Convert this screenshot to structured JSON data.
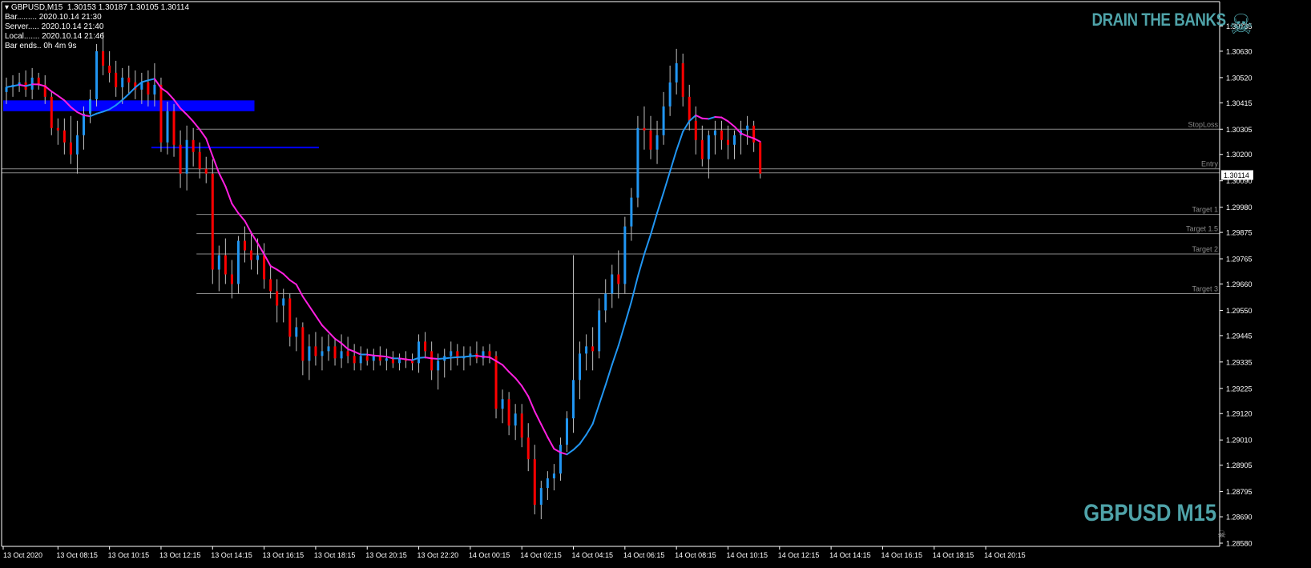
{
  "header": {
    "symbol_line": "GBPUSD,M15  1.30153 1.30187 1.30105 1.30114",
    "info_rows": [
      "Bar......... 2020.10.14 21:30",
      "Server..... 2020.10.14 21:40",
      "Local....... 2020.10.14 21:46",
      "Bar ends.. 0h 4m 9s"
    ]
  },
  "branding": {
    "title": "DRAIN THE BANKS",
    "icon": "skull-crossbones-icon",
    "symbol_title": "GBPUSD M15"
  },
  "colors": {
    "background": "#000000",
    "bull": "#2196F3",
    "bear": "#FF0000",
    "wick": "#C0C0C0",
    "ma_down": "#FF1FE0",
    "ma_up": "#2196F3",
    "zone": "#0000FF",
    "brand": "#4FA3A9",
    "level_line": "#8a8a8a"
  },
  "chart_data": {
    "type": "candlestick",
    "title": "GBPUSD,M15",
    "ylim": [
      1.2858,
      1.3079
    ],
    "y_ticks": [
      "1.30735",
      "1.30630",
      "1.30520",
      "1.30415",
      "1.30305",
      "1.30200",
      "1.30090",
      "1.29980",
      "1.29875",
      "1.29765",
      "1.29660",
      "1.29550",
      "1.29445",
      "1.29335",
      "1.29225",
      "1.29120",
      "1.29010",
      "1.28905",
      "1.28795",
      "1.28690",
      "1.28580"
    ],
    "y_tick_values": [
      1.30735,
      1.3063,
      1.3052,
      1.30415,
      1.30305,
      1.302,
      1.3009,
      1.2998,
      1.29875,
      1.29765,
      1.2966,
      1.2955,
      1.29445,
      1.29335,
      1.29225,
      1.2912,
      1.2901,
      1.28905,
      1.28795,
      1.2869,
      1.2858
    ],
    "x_ticks": [
      "13 Oct 2020",
      "13 Oct 08:15",
      "13 Oct 10:15",
      "13 Oct 12:15",
      "13 Oct 14:15",
      "13 Oct 16:15",
      "13 Oct 18:15",
      "13 Oct 20:15",
      "13 Oct 22:20",
      "14 Oct 00:15",
      "14 Oct 02:15",
      "14 Oct 04:15",
      "14 Oct 06:15",
      "14 Oct 08:15",
      "14 Oct 10:15",
      "14 Oct 12:15",
      "14 Oct 14:15",
      "14 Oct 16:15",
      "14 Oct 18:15",
      "14 Oct 20:15"
    ],
    "x_tick_index": [
      0,
      8,
      16,
      24,
      32,
      40,
      48,
      56,
      64,
      72,
      80,
      88,
      96,
      104,
      112,
      120,
      128,
      136,
      144,
      152
    ],
    "current_price": "1.30114",
    "current_price_value": 1.30114,
    "levels": [
      {
        "label": "StopLoss",
        "value": 1.30305,
        "from_index": 30
      },
      {
        "label": "Entry",
        "value": 1.3014,
        "from_index": 0
      },
      {
        "label": "Target 1",
        "value": 1.2995,
        "from_index": 30
      },
      {
        "label": "Target 1.5",
        "value": 1.2987,
        "from_index": 30
      },
      {
        "label": "Target 2",
        "value": 1.29785,
        "from_index": 30
      },
      {
        "label": "Target 3",
        "value": 1.2962,
        "from_index": 30
      }
    ],
    "zones": [
      {
        "from_index": 0,
        "to_index": 38,
        "top": 1.30425,
        "bottom": 1.3038
      },
      {
        "from_index": 23,
        "to_index": 48,
        "top": 1.30232,
        "bottom": 1.30226
      }
    ],
    "candles": [
      [
        1.3046,
        1.3052,
        1.3041,
        1.3048
      ],
      [
        1.3048,
        1.3053,
        1.3044,
        1.3049
      ],
      [
        1.3049,
        1.3054,
        1.3046,
        1.305
      ],
      [
        1.305,
        1.3055,
        1.3044,
        1.3047
      ],
      [
        1.3047,
        1.3056,
        1.3043,
        1.3052
      ],
      [
        1.3052,
        1.3054,
        1.3047,
        1.3049
      ],
      [
        1.3049,
        1.3053,
        1.3041,
        1.3044
      ],
      [
        1.3044,
        1.3046,
        1.3028,
        1.3031
      ],
      [
        1.3031,
        1.3035,
        1.3024,
        1.303
      ],
      [
        1.303,
        1.3035,
        1.302,
        1.3025
      ],
      [
        1.3025,
        1.3036,
        1.3016,
        1.302
      ],
      [
        1.302,
        1.3034,
        1.3012,
        1.3028
      ],
      [
        1.3028,
        1.304,
        1.3022,
        1.3037
      ],
      [
        1.3037,
        1.3047,
        1.3033,
        1.3043
      ],
      [
        1.3043,
        1.3066,
        1.304,
        1.3063
      ],
      [
        1.3063,
        1.3071,
        1.3053,
        1.3057
      ],
      [
        1.3057,
        1.3063,
        1.305,
        1.3054
      ],
      [
        1.3054,
        1.3059,
        1.3044,
        1.3048
      ],
      [
        1.3048,
        1.3056,
        1.3041,
        1.3052
      ],
      [
        1.3052,
        1.3057,
        1.3045,
        1.305
      ],
      [
        1.305,
        1.3055,
        1.3043,
        1.3047
      ],
      [
        1.3047,
        1.3054,
        1.3041,
        1.305
      ],
      [
        1.305,
        1.3055,
        1.304,
        1.3045
      ],
      [
        1.3045,
        1.3058,
        1.304,
        1.3049
      ],
      [
        1.3049,
        1.3052,
        1.3021,
        1.3025
      ],
      [
        1.3025,
        1.3042,
        1.302,
        1.3038
      ],
      [
        1.3038,
        1.3041,
        1.3019,
        1.3024
      ],
      [
        1.3024,
        1.303,
        1.3006,
        1.3012
      ],
      [
        1.3012,
        1.3032,
        1.3005,
        1.3026
      ],
      [
        1.3026,
        1.3031,
        1.3015,
        1.3021
      ],
      [
        1.3021,
        1.3025,
        1.301,
        1.3014
      ],
      [
        1.3014,
        1.3019,
        1.3008,
        1.3012
      ],
      [
        1.3012,
        1.3018,
        1.2966,
        1.2972
      ],
      [
        1.2972,
        1.2982,
        1.2963,
        1.2978
      ],
      [
        1.2978,
        1.2985,
        1.2966,
        1.297
      ],
      [
        1.297,
        1.2976,
        1.296,
        1.2966
      ],
      [
        1.2966,
        1.2986,
        1.2962,
        1.2984
      ],
      [
        1.2984,
        1.299,
        1.2975,
        1.298
      ],
      [
        1.298,
        1.2988,
        1.2972,
        1.2976
      ],
      [
        1.2976,
        1.2985,
        1.297,
        1.2978
      ],
      [
        1.2978,
        1.2983,
        1.2964,
        1.2968
      ],
      [
        1.2968,
        1.2974,
        1.296,
        1.2963
      ],
      [
        1.2963,
        1.2968,
        1.295,
        1.2957
      ],
      [
        1.2957,
        1.2964,
        1.295,
        1.296
      ],
      [
        1.296,
        1.2962,
        1.294,
        1.2944
      ],
      [
        1.2944,
        1.2952,
        1.2938,
        1.2948
      ],
      [
        1.2948,
        1.295,
        1.2928,
        1.2934
      ],
      [
        1.2934,
        1.2945,
        1.2926,
        1.294
      ],
      [
        1.294,
        1.2946,
        1.2932,
        1.2936
      ],
      [
        1.2936,
        1.2944,
        1.293,
        1.2938
      ],
      [
        1.2938,
        1.2945,
        1.2934,
        1.294
      ],
      [
        1.294,
        1.2943,
        1.2932,
        1.2935
      ],
      [
        1.2935,
        1.2945,
        1.2931,
        1.2938
      ],
      [
        1.2938,
        1.2944,
        1.2933,
        1.2936
      ],
      [
        1.2936,
        1.2941,
        1.293,
        1.2933
      ],
      [
        1.2933,
        1.294,
        1.293,
        1.2936
      ],
      [
        1.2936,
        1.2939,
        1.2932,
        1.2934
      ],
      [
        1.2934,
        1.2939,
        1.293,
        1.2936
      ],
      [
        1.2936,
        1.294,
        1.2932,
        1.2934
      ],
      [
        1.2934,
        1.2939,
        1.293,
        1.2935
      ],
      [
        1.2935,
        1.2938,
        1.2931,
        1.2933
      ],
      [
        1.2933,
        1.2937,
        1.293,
        1.2935
      ],
      [
        1.2935,
        1.2938,
        1.2931,
        1.2934
      ],
      [
        1.2934,
        1.2937,
        1.293,
        1.2933
      ],
      [
        1.2933,
        1.2945,
        1.2929,
        1.2942
      ],
      [
        1.2942,
        1.2946,
        1.2935,
        1.2938
      ],
      [
        1.2938,
        1.2942,
        1.2926,
        1.293
      ],
      [
        1.293,
        1.2937,
        1.2922,
        1.2934
      ],
      [
        1.2934,
        1.2939,
        1.2927,
        1.2936
      ],
      [
        1.2936,
        1.2942,
        1.293,
        1.2938
      ],
      [
        1.2938,
        1.2941,
        1.2932,
        1.2935
      ],
      [
        1.2935,
        1.294,
        1.293,
        1.2936
      ],
      [
        1.2936,
        1.294,
        1.2932,
        1.2937
      ],
      [
        1.2937,
        1.2942,
        1.2933,
        1.2935
      ],
      [
        1.2935,
        1.294,
        1.2932,
        1.2938
      ],
      [
        1.2938,
        1.2941,
        1.2933,
        1.2936
      ],
      [
        1.2936,
        1.2938,
        1.291,
        1.2914
      ],
      [
        1.2914,
        1.2922,
        1.2908,
        1.2918
      ],
      [
        1.2918,
        1.2921,
        1.2903,
        1.2907
      ],
      [
        1.2907,
        1.2916,
        1.2901,
        1.2912
      ],
      [
        1.2912,
        1.2916,
        1.2898,
        1.2902
      ],
      [
        1.2902,
        1.2908,
        1.2888,
        1.2893
      ],
      [
        1.2893,
        1.2899,
        1.287,
        1.2874
      ],
      [
        1.2874,
        1.2884,
        1.2868,
        1.2881
      ],
      [
        1.2881,
        1.2888,
        1.2876,
        1.2885
      ],
      [
        1.2885,
        1.2891,
        1.288,
        1.2887
      ],
      [
        1.2887,
        1.2902,
        1.2884,
        1.2899
      ],
      [
        1.2899,
        1.2913,
        1.2896,
        1.291
      ],
      [
        1.291,
        1.2978,
        1.2904,
        1.2926
      ],
      [
        1.2926,
        1.2942,
        1.2918,
        1.2937
      ],
      [
        1.2937,
        1.2945,
        1.293,
        1.294
      ],
      [
        1.294,
        1.2948,
        1.293,
        1.2938
      ],
      [
        1.2938,
        1.296,
        1.2935,
        1.2955
      ],
      [
        1.2955,
        1.2968,
        1.295,
        1.2962
      ],
      [
        1.2962,
        1.2974,
        1.2956,
        1.297
      ],
      [
        1.297,
        1.298,
        1.296,
        1.2966
      ],
      [
        1.2966,
        1.2994,
        1.2962,
        1.299
      ],
      [
        1.299,
        1.3006,
        1.2984,
        1.3002
      ],
      [
        1.3002,
        1.3036,
        1.2998,
        1.3031
      ],
      [
        1.3031,
        1.304,
        1.3022,
        1.303
      ],
      [
        1.303,
        1.3036,
        1.3018,
        1.3022
      ],
      [
        1.3022,
        1.3034,
        1.3016,
        1.3028
      ],
      [
        1.3028,
        1.3046,
        1.3024,
        1.304
      ],
      [
        1.304,
        1.3057,
        1.3036,
        1.305
      ],
      [
        1.305,
        1.3064,
        1.3045,
        1.3058
      ],
      [
        1.3058,
        1.3062,
        1.304,
        1.3044
      ],
      [
        1.3044,
        1.3049,
        1.303,
        1.3034
      ],
      [
        1.3034,
        1.304,
        1.302,
        1.3026
      ],
      [
        1.3026,
        1.3032,
        1.3015,
        1.3018
      ],
      [
        1.3018,
        1.303,
        1.301,
        1.3028
      ],
      [
        1.3028,
        1.3034,
        1.302,
        1.303
      ],
      [
        1.303,
        1.3034,
        1.3022,
        1.3026
      ],
      [
        1.3026,
        1.3032,
        1.3018,
        1.3024
      ],
      [
        1.3024,
        1.303,
        1.3018,
        1.3028
      ],
      [
        1.3028,
        1.3034,
        1.302,
        1.303
      ],
      [
        1.303,
        1.3036,
        1.3024,
        1.3032
      ],
      [
        1.3032,
        1.3034,
        1.3021,
        1.3025
      ],
      [
        1.3025,
        1.302,
        1.301,
        1.3012
      ]
    ]
  }
}
